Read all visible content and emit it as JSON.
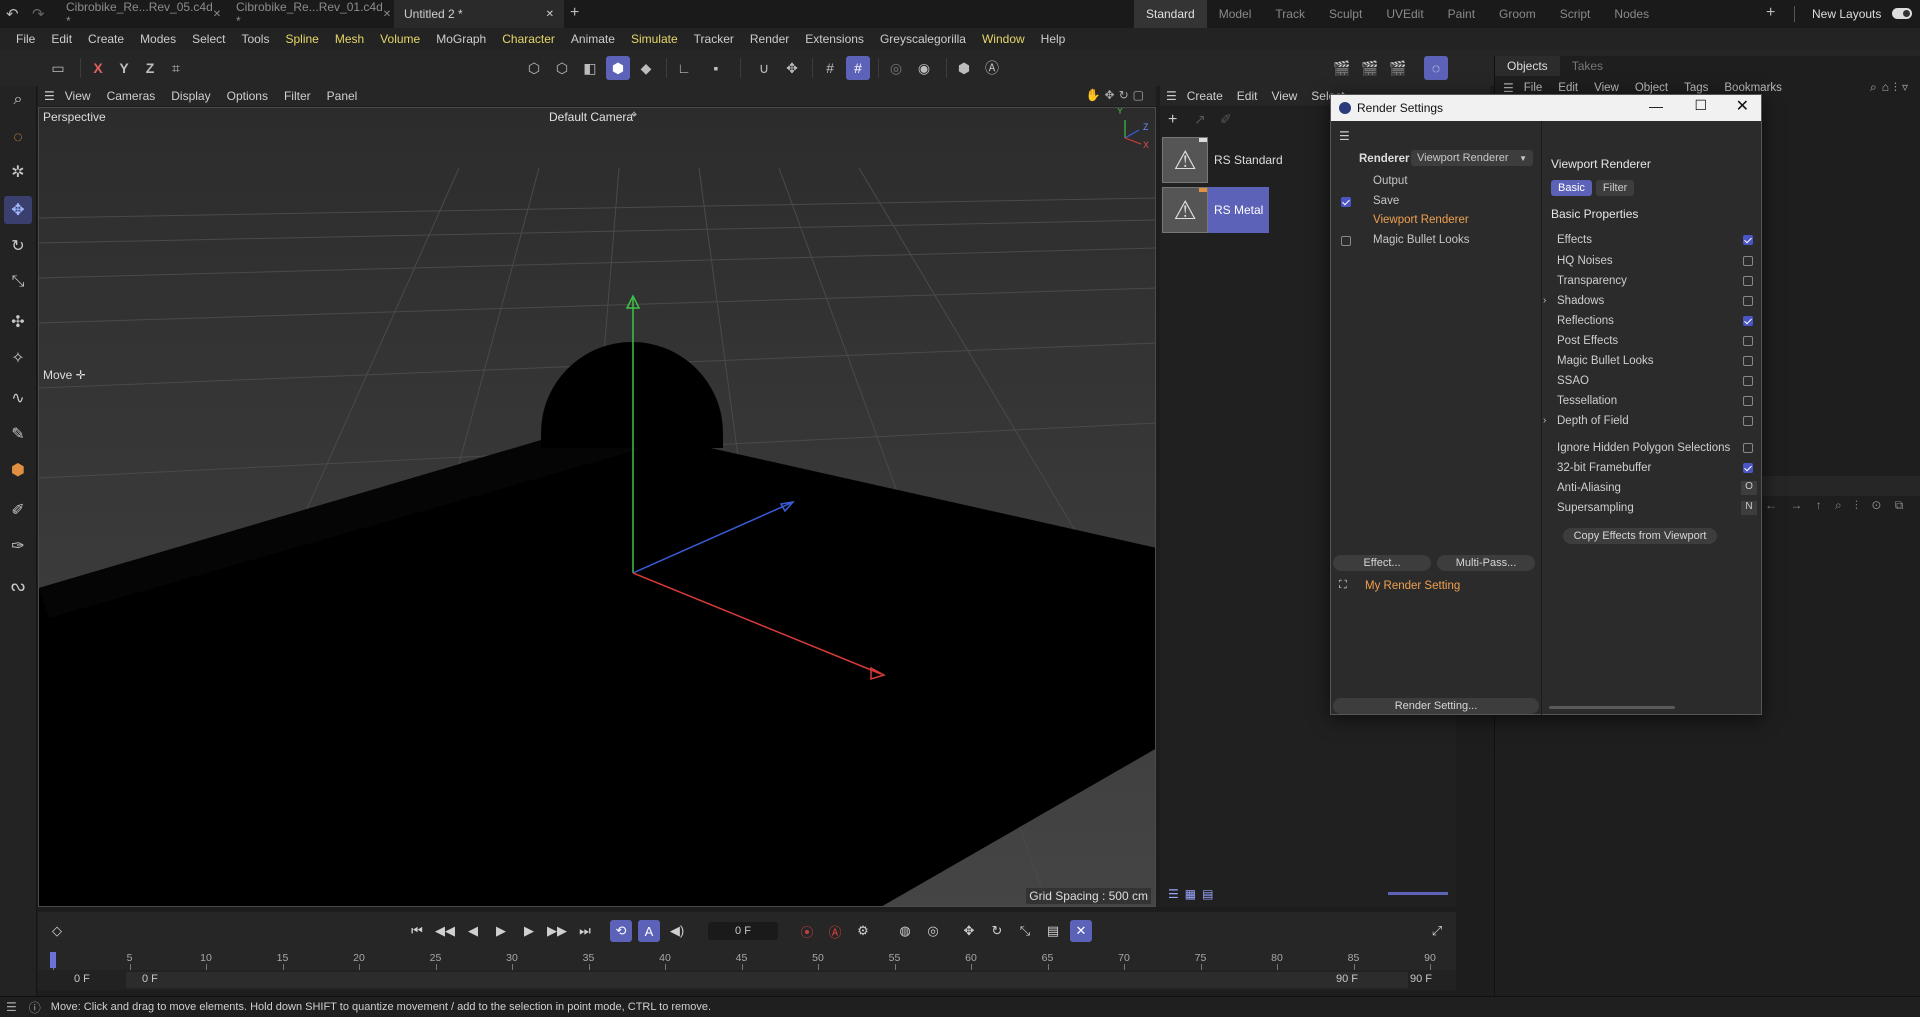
{
  "doc_tabs": [
    {
      "label": "Cibrobike_Re...Rev_05.c4d *",
      "active": false
    },
    {
      "label": "Cibrobike_Re...Rev_01.c4d *",
      "active": false
    },
    {
      "label": "Untitled 2 *",
      "active": true
    }
  ],
  "layout_tabs": [
    "Standard",
    "Model",
    "Track",
    "Sculpt",
    "UVEdit",
    "Paint",
    "Groom",
    "Script",
    "Nodes"
  ],
  "active_layout": "Standard",
  "new_layouts_label": "New Layouts",
  "menu": [
    "File",
    "Edit",
    "Create",
    "Modes",
    "Select",
    "Tools",
    "Spline",
    "Mesh",
    "Volume",
    "MoGraph",
    "Character",
    "Animate",
    "Simulate",
    "Tracker",
    "Render",
    "Extensions",
    "Greyscalegorilla",
    "Window",
    "Help"
  ],
  "toolbar": {
    "axis_x": "X",
    "axis_y": "Y",
    "axis_z": "Z"
  },
  "viewport": {
    "menu": [
      "View",
      "Cameras",
      "Display",
      "Options",
      "Filter",
      "Panel"
    ],
    "label": "Perspective",
    "camera": "Default Camera",
    "camera_icon": "⌖",
    "move_label": "Move",
    "grid_spacing": "Grid Spacing : 500 cm",
    "axis_labels": {
      "y": "Y",
      "z": "Z",
      "x": "X"
    }
  },
  "materials": {
    "menu": [
      "Create",
      "Edit",
      "View",
      "Select"
    ],
    "items": [
      {
        "name": "RS Standard",
        "selected": false
      },
      {
        "name": "RS Metal",
        "selected": true
      }
    ]
  },
  "objects": {
    "tabs": [
      "Objects",
      "Takes"
    ],
    "menu": [
      "File",
      "Edit",
      "View",
      "Object",
      "Tags",
      "Bookmarks"
    ]
  },
  "render_settings": {
    "title": "Render Settings",
    "renderer_label": "Renderer",
    "renderer_value": "Viewport Renderer",
    "left_items": [
      {
        "label": "Output",
        "check": "none",
        "active": false
      },
      {
        "label": "Save",
        "check": "on",
        "active": false
      },
      {
        "label": "Viewport Renderer",
        "check": "none",
        "active": true
      },
      {
        "label": "Magic Bullet Looks",
        "check": "off",
        "active": false
      }
    ],
    "effect_btn": "Effect...",
    "multipass_btn": "Multi-Pass...",
    "setting_name": "My Render Setting",
    "render_setting_btn": "Render Setting...",
    "right_title": "Viewport Renderer",
    "tab_basic": "Basic",
    "tab_filter": "Filter",
    "section": "Basic Properties",
    "properties": [
      {
        "label": "Effects",
        "checked": true,
        "expand": false
      },
      {
        "label": "HQ Noises",
        "checked": false,
        "expand": false
      },
      {
        "label": "Transparency",
        "checked": false,
        "expand": false
      },
      {
        "label": "Shadows",
        "checked": false,
        "expand": true
      },
      {
        "label": "Reflections",
        "checked": true,
        "expand": false
      },
      {
        "label": "Post Effects",
        "checked": false,
        "expand": false
      },
      {
        "label": "Magic Bullet Looks",
        "checked": false,
        "expand": false
      },
      {
        "label": "SSAO",
        "checked": false,
        "expand": false
      },
      {
        "label": "Tessellation",
        "checked": false,
        "expand": false
      },
      {
        "label": "Depth of Field",
        "checked": false,
        "expand": true
      },
      {
        "label": "Ignore Hidden Polygon Selections",
        "checked": false,
        "expand": false
      },
      {
        "label": "32-bit Framebuffer",
        "checked": true,
        "expand": false
      },
      {
        "label": "Anti-Aliasing",
        "value": "O",
        "expand": false
      },
      {
        "label": "Supersampling",
        "value": "N",
        "expand": false
      }
    ],
    "copy_btn": "Copy Effects from Viewport"
  },
  "timeline": {
    "current_frame": "0 F",
    "start_frame": "0 F",
    "start_frame2": "0 F",
    "end_frame": "90 F",
    "end_frame2": "90 F",
    "ticks": [
      "0",
      "5",
      "10",
      "15",
      "20",
      "25",
      "30",
      "35",
      "40",
      "45",
      "50",
      "55",
      "60",
      "65",
      "70",
      "75",
      "80",
      "85",
      "90"
    ]
  },
  "status": "Move: Click and drag to move elements. Hold down SHIFT to quantize movement / add to the selection in point mode, CTRL to remove.",
  "colors": {
    "accent": "#5b62b8",
    "active_text": "#f0a050",
    "menu_highlight": "#e6d66a"
  }
}
